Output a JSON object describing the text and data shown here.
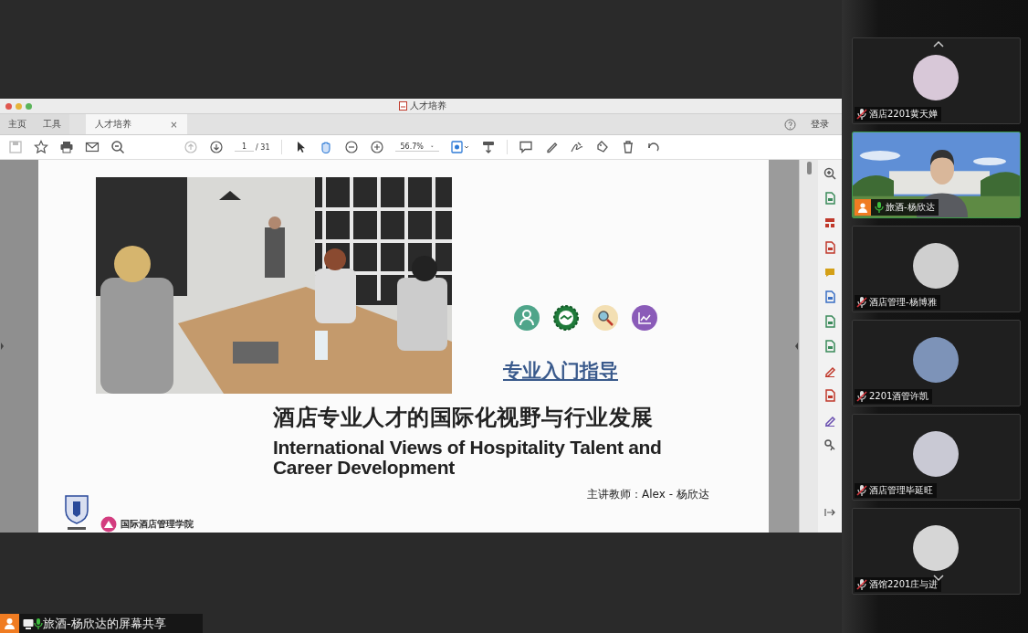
{
  "window": {
    "title": "人才培养"
  },
  "tabs": [
    {
      "label": "主页",
      "selected": false
    },
    {
      "label": "工具",
      "selected": false
    },
    {
      "label": "人才培养",
      "selected": true,
      "close": "×"
    }
  ],
  "account": {
    "label": "登录"
  },
  "toolbar": {
    "page": "1",
    "page_total": "/ 31",
    "zoom": "56.7%"
  },
  "slide": {
    "subtitle": "专业入门指导",
    "title_zh": "酒店专业人才的国际化视野与行业发展",
    "title_en": "International Views of Hospitality Talent and Career Development",
    "school": "国际酒店管理学院",
    "lecturer": "主讲教师：Alex - 杨欣达"
  },
  "participants": [
    {
      "name": "酒店2201黄天婵",
      "kind": "avatar",
      "speaking": false,
      "color": "#d8c8d8"
    },
    {
      "name": "旅酒-杨欣达",
      "kind": "video",
      "speaking": true
    },
    {
      "name": "酒店管理-杨博雅",
      "kind": "avatar",
      "speaking": false,
      "color": "#cfcfcf"
    },
    {
      "name": "2201酒管许凯",
      "kind": "avatar",
      "speaking": false,
      "color": "#7d93b8"
    },
    {
      "name": "酒店管理毕延旺",
      "kind": "avatar",
      "speaking": false,
      "color": "#c9c9d4"
    },
    {
      "name": "酒馆2201庄与进",
      "kind": "avatar",
      "speaking": false,
      "color": "#d6d6d6"
    }
  ],
  "share": {
    "label": "旅酒-杨欣达的屏幕共享"
  }
}
